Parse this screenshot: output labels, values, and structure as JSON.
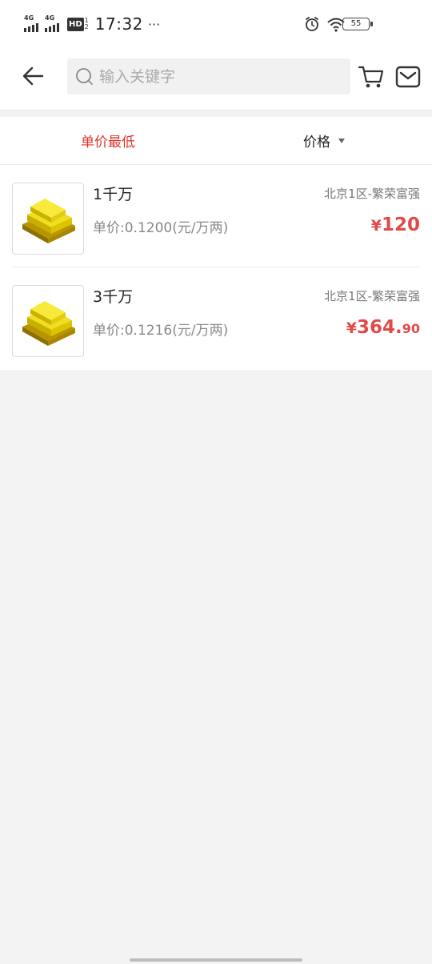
{
  "status_bar": {
    "network1": "4G",
    "network2": "4G",
    "hd_label": "HD",
    "hd_sub": "1\n2",
    "time": "17:32",
    "more": "···",
    "battery": "55"
  },
  "header": {
    "search_placeholder": "输入关键字",
    "icons": [
      "back-arrow-icon",
      "search-icon",
      "cart-icon",
      "mail-icon"
    ]
  },
  "sort_bar": {
    "options": [
      {
        "label": "单价最低",
        "active": true
      },
      {
        "label": "价格",
        "active": false
      }
    ]
  },
  "items": [
    {
      "title": "1千万",
      "server": "北京1区-繁荣富强",
      "unit_price": "单价:0.1200(元/万两)",
      "price_symbol": "¥",
      "price_int": "120",
      "price_dec": ""
    },
    {
      "title": "3千万",
      "server": "北京1区-繁荣富强",
      "unit_price": "单价:0.1216(元/万两)",
      "price_symbol": "¥",
      "price_int": "364.",
      "price_dec": "90"
    }
  ],
  "colors": {
    "accent": "#e0352b",
    "price": "#e14a4a",
    "background": "#f3f3f3"
  }
}
